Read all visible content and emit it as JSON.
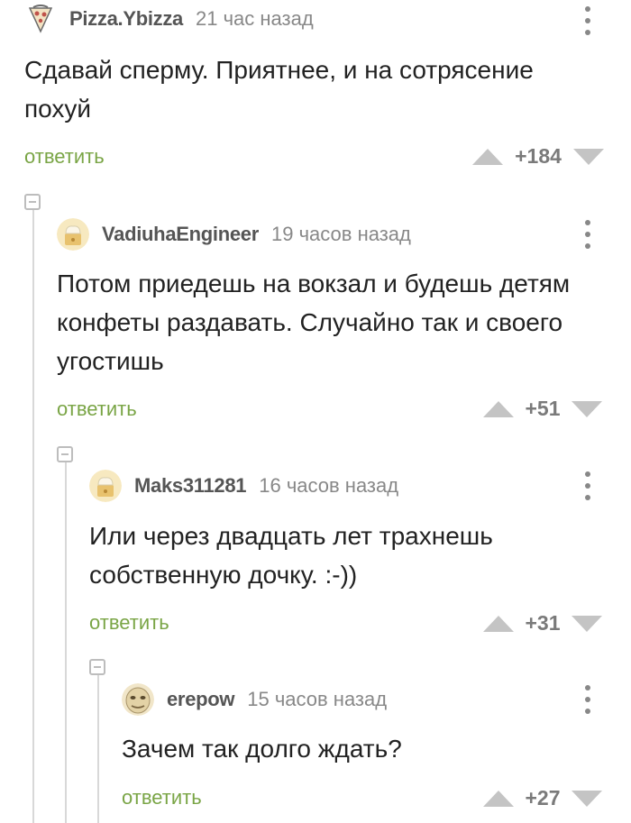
{
  "comments": [
    {
      "username": "Pizza.Ybizza",
      "time": "21 час назад",
      "text_lines": [
        "Сдавай сперму. Приятнее, и на сотрясение",
        "похуй"
      ],
      "reply_label": "ответить",
      "rating": "+184",
      "avatar": "pizza-avatar"
    },
    {
      "username": "VadiuhaEngineer",
      "time": "19 часов назад",
      "text_lines": [
        "Потом приедешь на вокзал и будешь детям",
        "конфеты раздавать. Случайно так и своего",
        "угостишь"
      ],
      "reply_label": "ответить",
      "rating": "+51",
      "avatar": "default-chef-avatar"
    },
    {
      "username": "Maks311281",
      "time": "16 часов назад",
      "text_lines": [
        "Или через двадцать лет трахнешь",
        "собственную дочку. :-))"
      ],
      "reply_label": "ответить",
      "rating": "+31",
      "avatar": "default-chef-avatar"
    },
    {
      "username": "erepow",
      "time": "15 часов назад",
      "text_lines": [
        "Зачем так долго ждать?"
      ],
      "reply_label": "ответить",
      "rating": "+27",
      "avatar": "face-avatar"
    }
  ],
  "colors": {
    "reply_green": "#7aa546",
    "vote_gray": "#c4c4c4",
    "thread_line": "#d8d8d8"
  }
}
